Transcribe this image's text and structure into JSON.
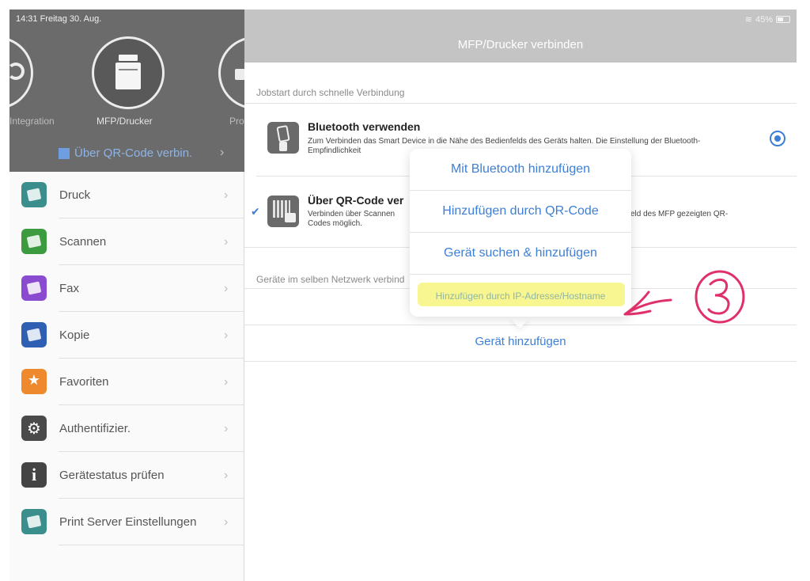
{
  "status_bar": {
    "time_date": "14:31  Freitag 30. Aug.",
    "battery": "45%"
  },
  "carousel": {
    "left_label": "Integration",
    "main_label": "MFP/Drucker",
    "right_label": "Pro",
    "qr_connect_label": "Über QR-Code verbin."
  },
  "sidebar": {
    "items": [
      {
        "label": "Druck",
        "icon": "print-icon"
      },
      {
        "label": "Scannen",
        "icon": "scan-icon"
      },
      {
        "label": "Fax",
        "icon": "fax-icon"
      },
      {
        "label": "Kopie",
        "icon": "copy-icon"
      },
      {
        "label": "Favoriten",
        "icon": "star-icon"
      },
      {
        "label": "Authentifizier.",
        "icon": "gear-icon"
      },
      {
        "label": "Gerätestatus prüfen",
        "icon": "info-icon"
      },
      {
        "label": "Print Server Einstellungen",
        "icon": "print-server-icon"
      }
    ]
  },
  "main": {
    "nav_title": "MFP/Drucker verbinden",
    "section_quick": "Jobstart durch schnelle Verbindung",
    "bluetooth": {
      "title": "Bluetooth verwenden",
      "desc": "Zum Verbinden das Smart Device in die Nähe des Bedienfelds des Geräts halten. Die Einstellung der Bluetooth-Empfindlichkeit"
    },
    "qr": {
      "title": "Über QR-Code ver",
      "desc_left": "Verbinden über Scannen Codes möglich.",
      "desc_right": "eld des MFP gezeigten QR-"
    },
    "section_network": "Geräte im selben Netzwerk verbind",
    "add_device": "Gerät hinzufügen"
  },
  "popover": {
    "items": [
      "Mit Bluetooth hinzufügen",
      "Hinzufügen durch QR-Code",
      "Gerät suchen & hinzufügen",
      "Hinzufügen durch IP-Adresse/Hostname"
    ]
  },
  "colors": {
    "accent": "#3d7fd6",
    "sidebar_header": "#6b6b6b",
    "nav_bar": "#c4c4c4",
    "highlight": "#f6f57d",
    "annotation": "#e0306a"
  }
}
